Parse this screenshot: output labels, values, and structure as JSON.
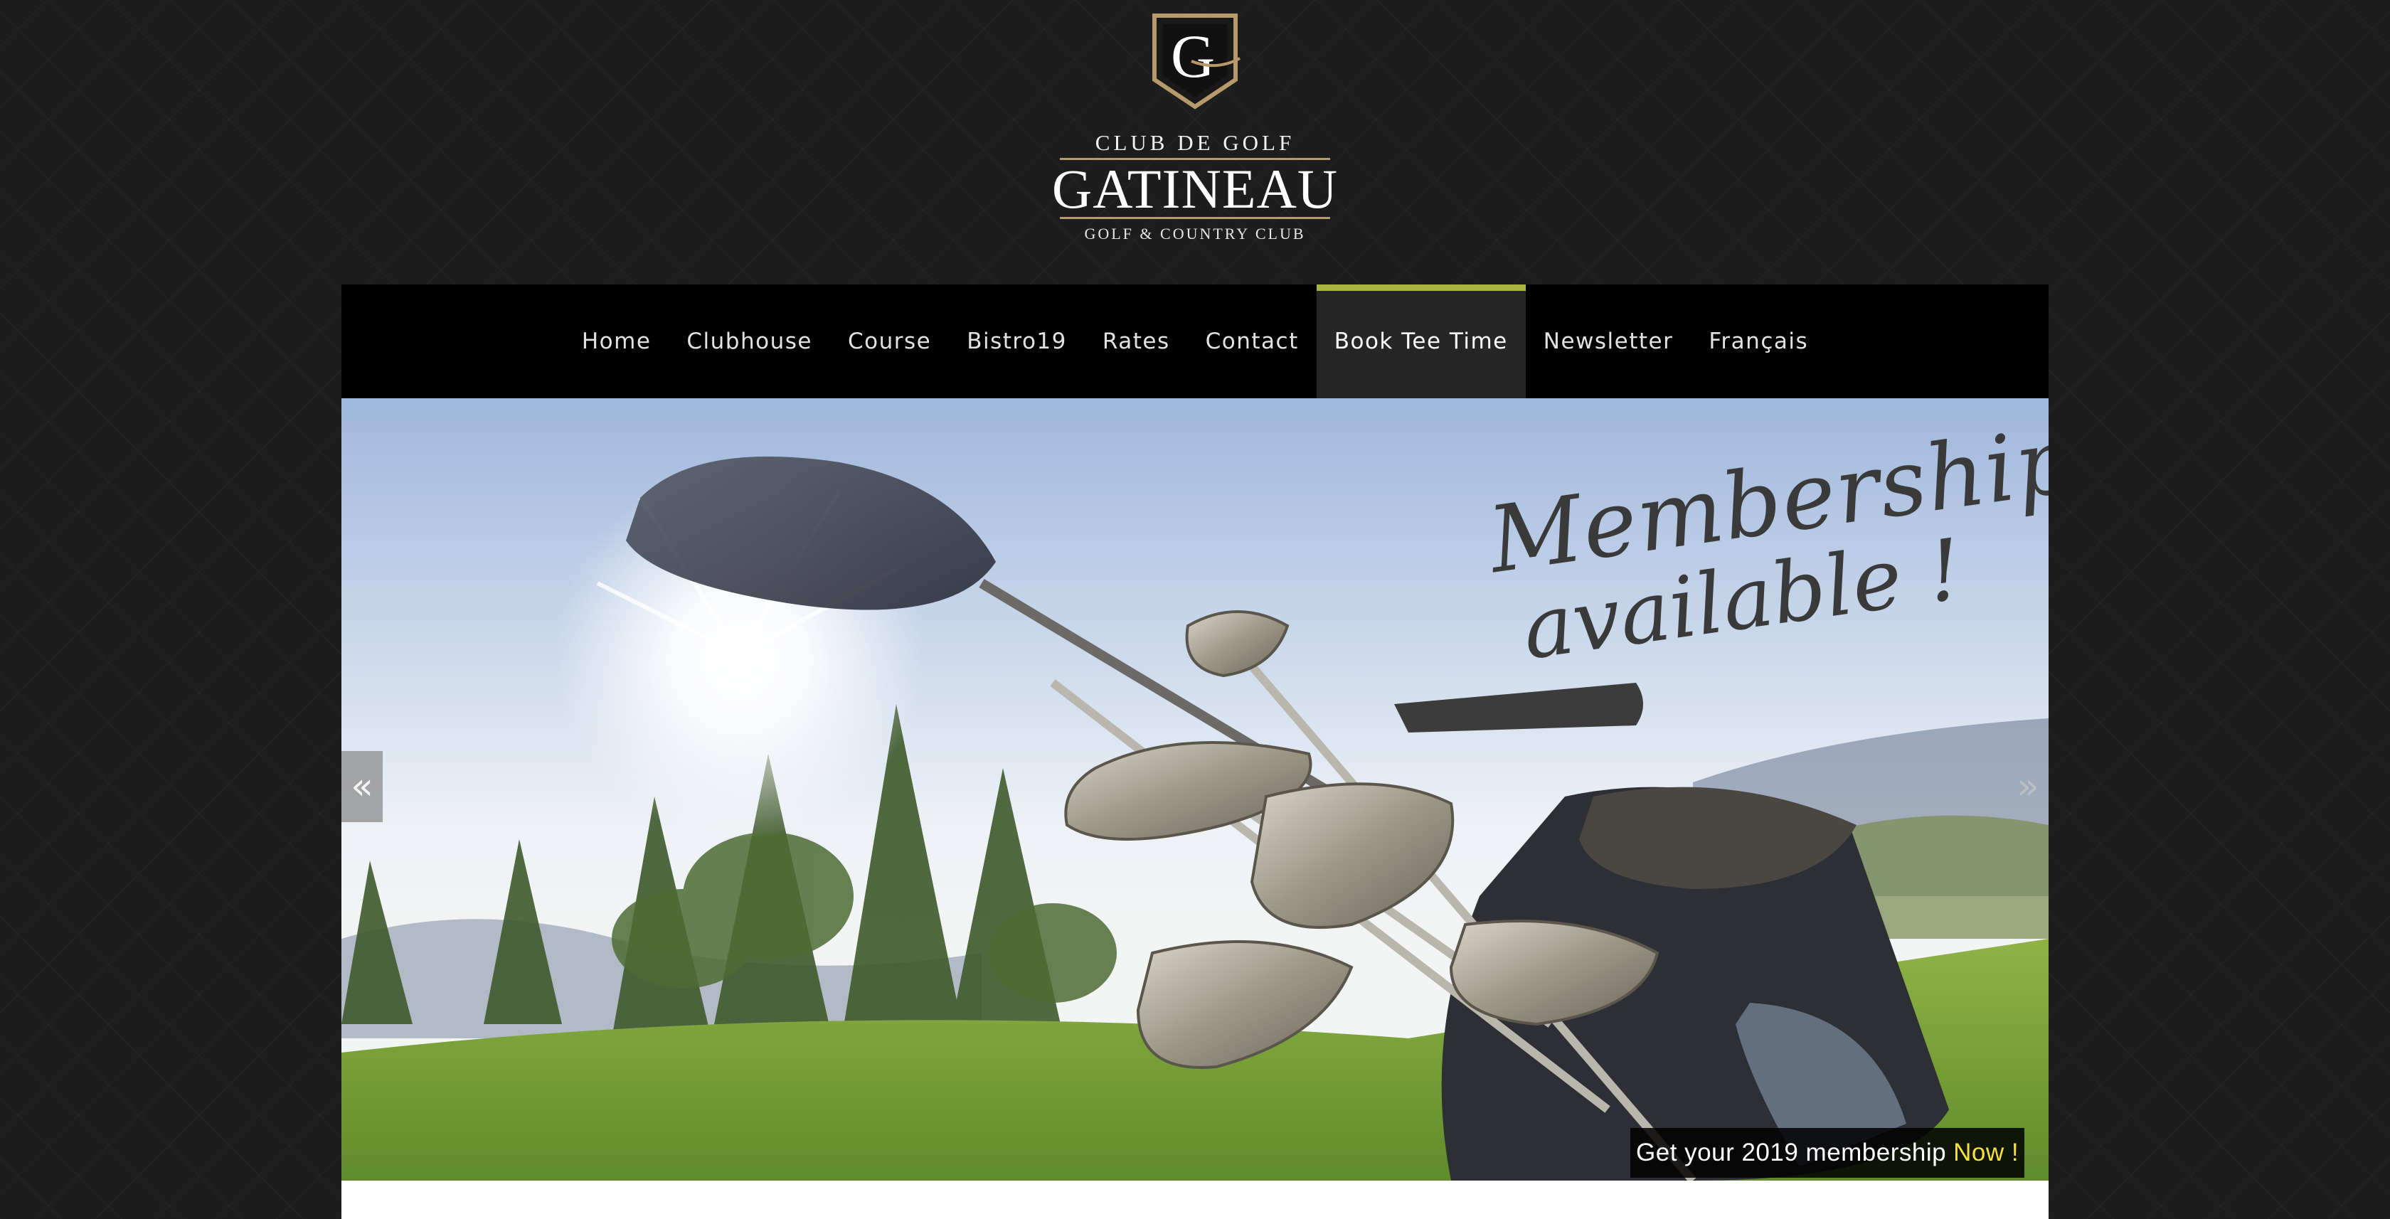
{
  "logo": {
    "crest_letter": "G",
    "top_text": "CLUB DE GOLF",
    "main_text": "GATINEAU",
    "sub_text": "GOLF & COUNTRY CLUB"
  },
  "nav": {
    "items": [
      {
        "label": "Home"
      },
      {
        "label": "Clubhouse"
      },
      {
        "label": "Course"
      },
      {
        "label": "Bistro19"
      },
      {
        "label": "Rates"
      },
      {
        "label": "Contact"
      },
      {
        "label": "Book Tee Time"
      },
      {
        "label": "Newsletter"
      },
      {
        "label": "Français"
      }
    ],
    "active_label": "Book Tee Time",
    "accent_color": "#a8b43f"
  },
  "hero": {
    "headline_line1": "Memberships",
    "headline_line2": "available !",
    "caption_text": "Get your 2019 membership",
    "caption_highlight": "Now !",
    "prev_arrow": "«",
    "next_arrow": "»",
    "highlight_color": "#f4e23a"
  },
  "icons": {
    "crest": "shield-crest-icon",
    "prev": "chevron-double-left-icon",
    "next": "chevron-double-right-icon"
  }
}
